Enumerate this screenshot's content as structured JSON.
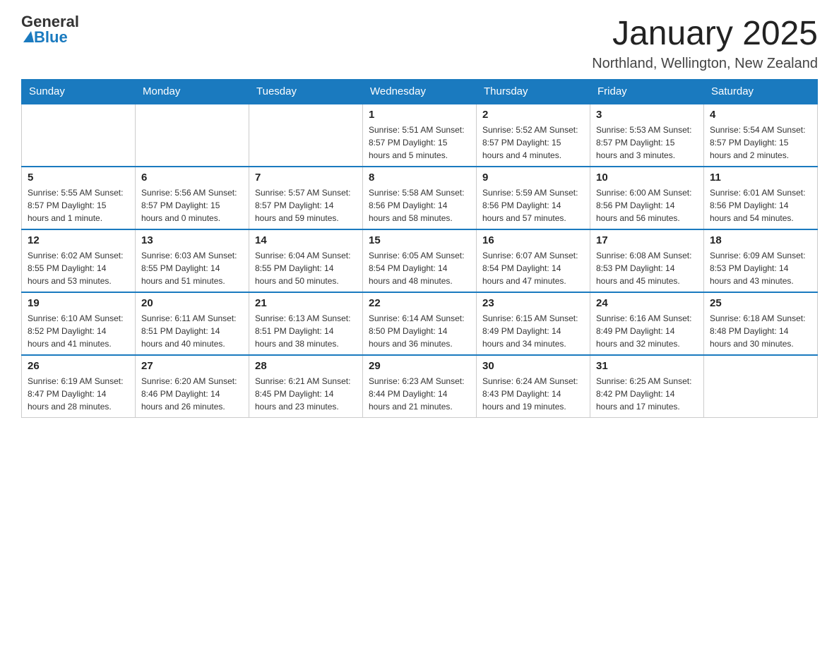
{
  "header": {
    "logo_general": "General",
    "logo_blue": "Blue",
    "month_title": "January 2025",
    "location": "Northland, Wellington, New Zealand"
  },
  "calendar": {
    "days_of_week": [
      "Sunday",
      "Monday",
      "Tuesday",
      "Wednesday",
      "Thursday",
      "Friday",
      "Saturday"
    ],
    "weeks": [
      [
        {
          "day": "",
          "info": ""
        },
        {
          "day": "",
          "info": ""
        },
        {
          "day": "",
          "info": ""
        },
        {
          "day": "1",
          "info": "Sunrise: 5:51 AM\nSunset: 8:57 PM\nDaylight: 15 hours and 5 minutes."
        },
        {
          "day": "2",
          "info": "Sunrise: 5:52 AM\nSunset: 8:57 PM\nDaylight: 15 hours and 4 minutes."
        },
        {
          "day": "3",
          "info": "Sunrise: 5:53 AM\nSunset: 8:57 PM\nDaylight: 15 hours and 3 minutes."
        },
        {
          "day": "4",
          "info": "Sunrise: 5:54 AM\nSunset: 8:57 PM\nDaylight: 15 hours and 2 minutes."
        }
      ],
      [
        {
          "day": "5",
          "info": "Sunrise: 5:55 AM\nSunset: 8:57 PM\nDaylight: 15 hours and 1 minute."
        },
        {
          "day": "6",
          "info": "Sunrise: 5:56 AM\nSunset: 8:57 PM\nDaylight: 15 hours and 0 minutes."
        },
        {
          "day": "7",
          "info": "Sunrise: 5:57 AM\nSunset: 8:57 PM\nDaylight: 14 hours and 59 minutes."
        },
        {
          "day": "8",
          "info": "Sunrise: 5:58 AM\nSunset: 8:56 PM\nDaylight: 14 hours and 58 minutes."
        },
        {
          "day": "9",
          "info": "Sunrise: 5:59 AM\nSunset: 8:56 PM\nDaylight: 14 hours and 57 minutes."
        },
        {
          "day": "10",
          "info": "Sunrise: 6:00 AM\nSunset: 8:56 PM\nDaylight: 14 hours and 56 minutes."
        },
        {
          "day": "11",
          "info": "Sunrise: 6:01 AM\nSunset: 8:56 PM\nDaylight: 14 hours and 54 minutes."
        }
      ],
      [
        {
          "day": "12",
          "info": "Sunrise: 6:02 AM\nSunset: 8:55 PM\nDaylight: 14 hours and 53 minutes."
        },
        {
          "day": "13",
          "info": "Sunrise: 6:03 AM\nSunset: 8:55 PM\nDaylight: 14 hours and 51 minutes."
        },
        {
          "day": "14",
          "info": "Sunrise: 6:04 AM\nSunset: 8:55 PM\nDaylight: 14 hours and 50 minutes."
        },
        {
          "day": "15",
          "info": "Sunrise: 6:05 AM\nSunset: 8:54 PM\nDaylight: 14 hours and 48 minutes."
        },
        {
          "day": "16",
          "info": "Sunrise: 6:07 AM\nSunset: 8:54 PM\nDaylight: 14 hours and 47 minutes."
        },
        {
          "day": "17",
          "info": "Sunrise: 6:08 AM\nSunset: 8:53 PM\nDaylight: 14 hours and 45 minutes."
        },
        {
          "day": "18",
          "info": "Sunrise: 6:09 AM\nSunset: 8:53 PM\nDaylight: 14 hours and 43 minutes."
        }
      ],
      [
        {
          "day": "19",
          "info": "Sunrise: 6:10 AM\nSunset: 8:52 PM\nDaylight: 14 hours and 41 minutes."
        },
        {
          "day": "20",
          "info": "Sunrise: 6:11 AM\nSunset: 8:51 PM\nDaylight: 14 hours and 40 minutes."
        },
        {
          "day": "21",
          "info": "Sunrise: 6:13 AM\nSunset: 8:51 PM\nDaylight: 14 hours and 38 minutes."
        },
        {
          "day": "22",
          "info": "Sunrise: 6:14 AM\nSunset: 8:50 PM\nDaylight: 14 hours and 36 minutes."
        },
        {
          "day": "23",
          "info": "Sunrise: 6:15 AM\nSunset: 8:49 PM\nDaylight: 14 hours and 34 minutes."
        },
        {
          "day": "24",
          "info": "Sunrise: 6:16 AM\nSunset: 8:49 PM\nDaylight: 14 hours and 32 minutes."
        },
        {
          "day": "25",
          "info": "Sunrise: 6:18 AM\nSunset: 8:48 PM\nDaylight: 14 hours and 30 minutes."
        }
      ],
      [
        {
          "day": "26",
          "info": "Sunrise: 6:19 AM\nSunset: 8:47 PM\nDaylight: 14 hours and 28 minutes."
        },
        {
          "day": "27",
          "info": "Sunrise: 6:20 AM\nSunset: 8:46 PM\nDaylight: 14 hours and 26 minutes."
        },
        {
          "day": "28",
          "info": "Sunrise: 6:21 AM\nSunset: 8:45 PM\nDaylight: 14 hours and 23 minutes."
        },
        {
          "day": "29",
          "info": "Sunrise: 6:23 AM\nSunset: 8:44 PM\nDaylight: 14 hours and 21 minutes."
        },
        {
          "day": "30",
          "info": "Sunrise: 6:24 AM\nSunset: 8:43 PM\nDaylight: 14 hours and 19 minutes."
        },
        {
          "day": "31",
          "info": "Sunrise: 6:25 AM\nSunset: 8:42 PM\nDaylight: 14 hours and 17 minutes."
        },
        {
          "day": "",
          "info": ""
        }
      ]
    ]
  }
}
